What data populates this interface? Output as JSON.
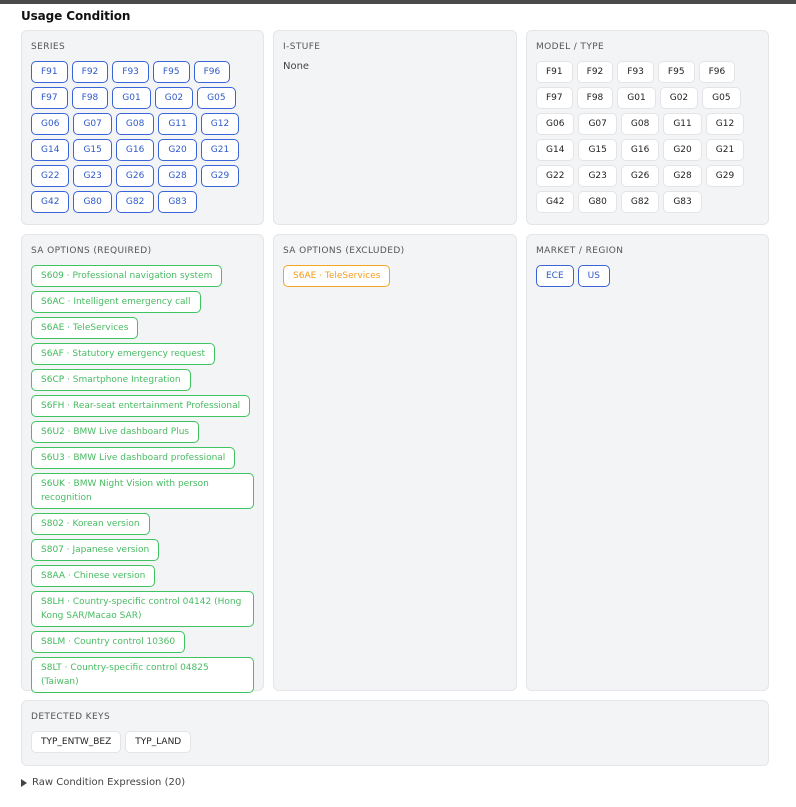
{
  "title": "Usage Condition",
  "series": {
    "title": "SERIES",
    "items": [
      "F91",
      "F92",
      "F93",
      "F95",
      "F96",
      "F97",
      "F98",
      "G01",
      "G02",
      "G05",
      "G06",
      "G07",
      "G08",
      "G11",
      "G12",
      "G14",
      "G15",
      "G16",
      "G20",
      "G21",
      "G22",
      "G23",
      "G26",
      "G28",
      "G29",
      "G42",
      "G80",
      "G82",
      "G83"
    ]
  },
  "istufe": {
    "title": "I-STUFE",
    "value": "None"
  },
  "model_type": {
    "title": "MODEL / TYPE",
    "items": [
      "F91",
      "F92",
      "F93",
      "F95",
      "F96",
      "F97",
      "F98",
      "G01",
      "G02",
      "G05",
      "G06",
      "G07",
      "G08",
      "G11",
      "G12",
      "G14",
      "G15",
      "G16",
      "G20",
      "G21",
      "G22",
      "G23",
      "G26",
      "G28",
      "G29",
      "G42",
      "G80",
      "G82",
      "G83"
    ]
  },
  "sa_required": {
    "title": "SA OPTIONS (REQUIRED)",
    "items": [
      {
        "code": "S609",
        "desc": "Professional navigation system"
      },
      {
        "code": "S6AC",
        "desc": "Intelligent emergency call"
      },
      {
        "code": "S6AE",
        "desc": "TeleServices"
      },
      {
        "code": "S6AF",
        "desc": "Statutory emergency request"
      },
      {
        "code": "S6CP",
        "desc": "Smartphone Integration"
      },
      {
        "code": "S6FH",
        "desc": "Rear-seat entertainment Professional"
      },
      {
        "code": "S6U2",
        "desc": "BMW Live dashboard Plus"
      },
      {
        "code": "S6U3",
        "desc": "BMW Live dashboard professional"
      },
      {
        "code": "S6UK",
        "desc": "BMW Night Vision with person recognition"
      },
      {
        "code": "S802",
        "desc": "Korean version"
      },
      {
        "code": "S807",
        "desc": "Japanese version"
      },
      {
        "code": "S8AA",
        "desc": "Chinese version"
      },
      {
        "code": "S8LH",
        "desc": "Country-specific control 04142 (Hong Kong SAR/Macao SAR)"
      },
      {
        "code": "S8LM",
        "desc": "Country control 10360"
      },
      {
        "code": "S8LT",
        "desc": "Country-specific control 04825 (Taiwan)"
      }
    ]
  },
  "sa_excluded": {
    "title": "SA OPTIONS (EXCLUDED)",
    "items": [
      {
        "code": "S6AE",
        "desc": "TeleServices"
      }
    ]
  },
  "market": {
    "title": "MARKET / REGION",
    "items": [
      "ECE",
      "US"
    ]
  },
  "detected_keys": {
    "title": "DETECTED KEYS",
    "items": [
      "TYP_ENTW_BEZ",
      "TYP_LAND"
    ]
  },
  "raw_expression": {
    "label": "Raw Condition Expression (20)"
  },
  "colors": {
    "blue": "#3b64d8",
    "green": "#3fc461",
    "orange": "#f5a524",
    "panel_bg": "#f3f4f6"
  }
}
